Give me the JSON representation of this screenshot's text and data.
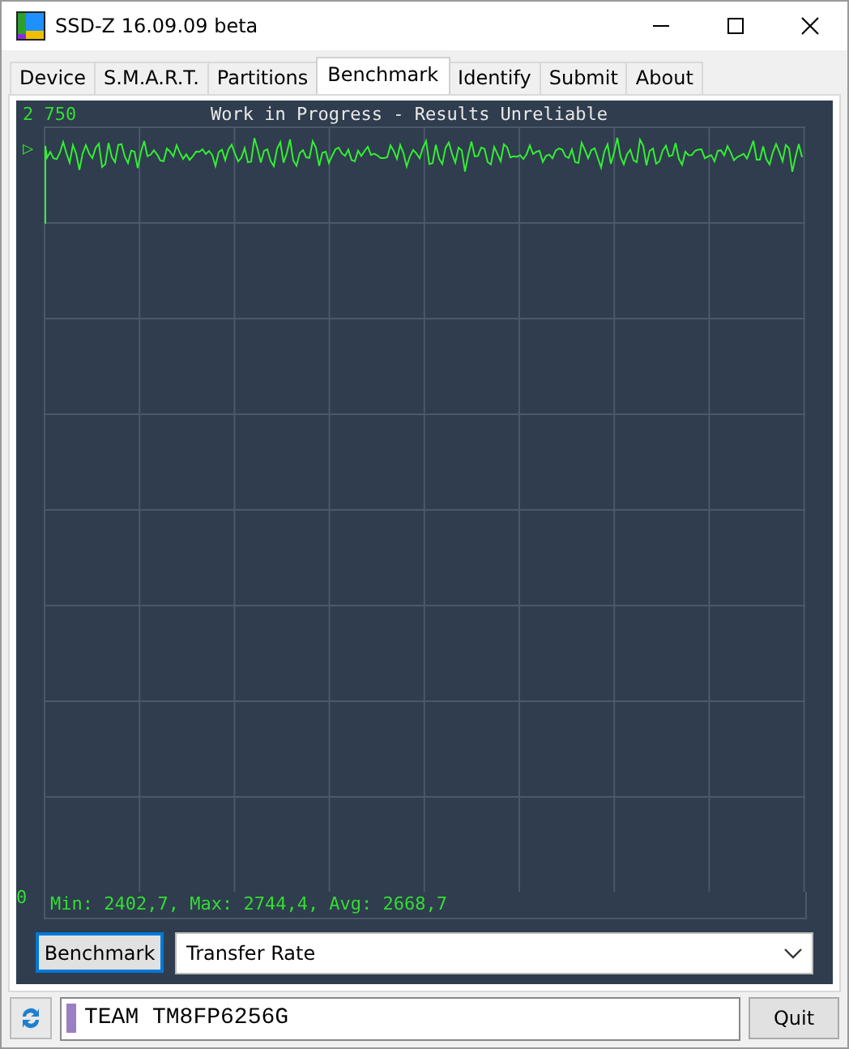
{
  "window": {
    "title": "SSD-Z 16.09.09 beta"
  },
  "tabs": [
    {
      "label": "Device",
      "selected": false
    },
    {
      "label": "S.M.A.R.T.",
      "selected": false
    },
    {
      "label": "Partitions",
      "selected": false
    },
    {
      "label": "Benchmark",
      "selected": true
    },
    {
      "label": "Identify",
      "selected": false
    },
    {
      "label": "Submit",
      "selected": false
    },
    {
      "label": "About",
      "selected": false
    }
  ],
  "graph": {
    "title": "Work in Progress - Results Unreliable",
    "y_max_label": "2 750",
    "y_min_label": "0",
    "marker": "▷",
    "stats": "Min: 2402,7, Max: 2744,4, Avg: 2668,7"
  },
  "controls": {
    "button": "Benchmark",
    "mode": "Transfer Rate"
  },
  "status_bar": {
    "device": "TEAM TM8FP6256G",
    "quit": "Quit"
  }
}
